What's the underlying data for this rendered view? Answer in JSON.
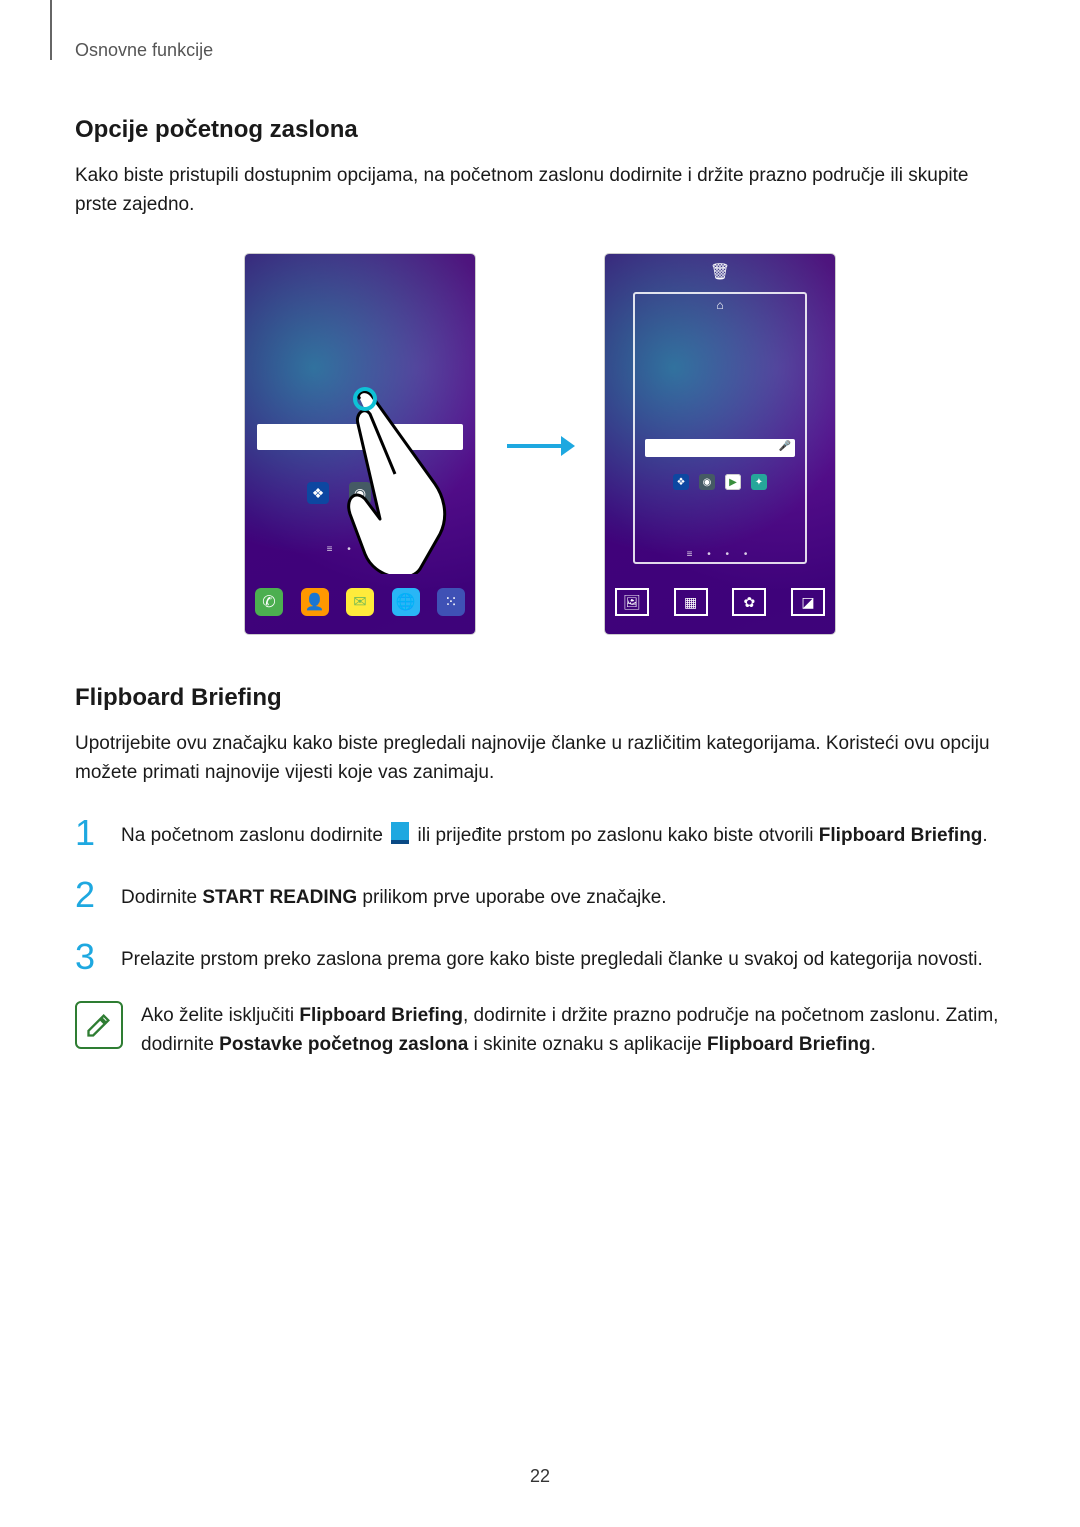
{
  "breadcrumb": "Osnovne funkcije",
  "page_number": "22",
  "section1": {
    "heading": "Opcije početnog zaslona",
    "para": "Kako biste pristupili dostupnim opcijama, na početnom zaslonu dodirnite i držite prazno područje ili skupite prste zajedno."
  },
  "section2": {
    "heading": "Flipboard Briefing",
    "intro": "Upotrijebite ovu značajku kako biste pregledali najnovije članke u različitim kategorijama. Koristeći ovu opciju možete primati najnovije vijesti koje vas zanimaju.",
    "steps": {
      "1": {
        "num": "1",
        "pre": "Na početnom zaslonu dodirnite ",
        "post": " ili prijeđite prstom po zaslonu kako biste otvorili ",
        "bold": "Flipboard Briefing",
        "tail": "."
      },
      "2": {
        "num": "2",
        "pre": "Dodirnite ",
        "bold": "START READING",
        "post": " prilikom prve uporabe ove značajke."
      },
      "3": {
        "num": "3",
        "text": "Prelazite prstom preko zaslona prema gore kako biste pregledali članke u svakoj od kategorija novosti."
      }
    },
    "note": {
      "pre1": "Ako želite isključiti ",
      "b1": "Flipboard Briefing",
      "mid1": ", dodirnite i držite prazno područje na početnom zaslonu. Zatim, dodirnite ",
      "b2": "Postavke početnog zaslona",
      "mid2": " i skinite oznaku s aplikacije ",
      "b3": "Flipboard Briefing",
      "tail": "."
    }
  },
  "icons": {
    "dropbox": "dropbox-icon",
    "camera": "camera-icon",
    "play": "play-store-icon",
    "phone": "phone-icon",
    "contacts": "contacts-icon",
    "messages": "messages-icon",
    "browser": "browser-icon",
    "apps": "apps-icon",
    "trash": "trash-icon",
    "home": "home-outline-icon",
    "wallpaper": "wallpaper-icon",
    "widgets": "widgets-icon",
    "settings": "settings-icon",
    "flipboard": "flipboard-icon",
    "arrow": "arrow-right-icon",
    "note": "note-pencil-icon"
  }
}
